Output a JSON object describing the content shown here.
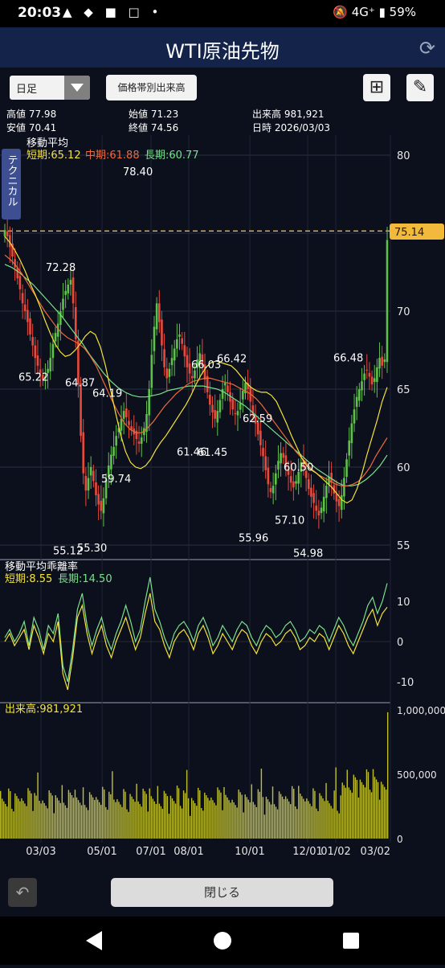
{
  "status": {
    "time": "20:03",
    "battery": "59%",
    "network": "4G⁺",
    "icons": "▲ ◆ ■ □ •"
  },
  "title": "WTI原油先物",
  "toolbar": {
    "period": "日足",
    "volume_profile_button": "価格帯別出来高"
  },
  "info": {
    "high_label": "高値",
    "high_value": "77.98",
    "open_label": "始値",
    "open_value": "71.23",
    "volume_label": "出来高",
    "volume_value": "981,921",
    "low_label": "安値",
    "low_value": "70.41",
    "close_label": "終値",
    "close_value": "74.56",
    "date_label": "日時",
    "date_value": "2026/03/03"
  },
  "side_tab": "テクニカル",
  "close_button": "閉じる",
  "colors": {
    "up": "#5ec24a",
    "down": "#e94a3a",
    "short_ma": "#f5e43a",
    "mid_ma": "#ef6a3c",
    "long_ma": "#7be08c",
    "volume": "#bfbf2c",
    "price_line": "#f2b93b",
    "bg": "#0c0f1c"
  },
  "chart_data": {
    "type": "candlestick",
    "price_panel": {
      "title": "移動平均",
      "legend": [
        {
          "label": "短期:65.12"
        },
        {
          "label": "中期:61.88"
        },
        {
          "label": "長期:60.77"
        }
      ],
      "ylim": [
        54,
        82
      ],
      "yticks": [
        "80",
        "75",
        "70",
        "65",
        "60",
        "55"
      ],
      "current_price": "75.14",
      "annotations": [
        {
          "text": "78.40",
          "x": 169,
          "y": 78.4
        },
        {
          "text": "72.28",
          "x": 73,
          "y": 72.28
        },
        {
          "text": "65.22",
          "x": 39,
          "y": 65.22
        },
        {
          "text": "64.87",
          "x": 97,
          "y": 64.87
        },
        {
          "text": "64.19",
          "x": 131,
          "y": 64.19
        },
        {
          "text": "59.74",
          "x": 142,
          "y": 59.74
        },
        {
          "text": "55.12",
          "x": 82,
          "y": 55.12
        },
        {
          "text": "55.30",
          "x": 112,
          "y": 55.3
        },
        {
          "text": "66.03",
          "x": 254,
          "y": 66.03
        },
        {
          "text": "66.42",
          "x": 286,
          "y": 66.42
        },
        {
          "text": "61.46",
          "x": 236,
          "y": 61.46
        },
        {
          "text": "61.45",
          "x": 262,
          "y": 61.45
        },
        {
          "text": "62.59",
          "x": 318,
          "y": 62.59
        },
        {
          "text": "60.50",
          "x": 369,
          "y": 60.5
        },
        {
          "text": "57.10",
          "x": 358,
          "y": 57.1
        },
        {
          "text": "55.96",
          "x": 313,
          "y": 55.96
        },
        {
          "text": "54.98",
          "x": 381,
          "y": 54.98
        },
        {
          "text": "66.48",
          "x": 431,
          "y": 66.48
        }
      ],
      "closes": [
        75.2,
        74.8,
        74.1,
        73.5,
        72.8,
        72.1,
        71.4,
        70.5,
        70.0,
        69.3,
        68.5,
        67.8,
        67.0,
        66.5,
        66.0,
        65.6,
        65.8,
        66.3,
        67.0,
        67.9,
        68.6,
        69.2,
        70.0,
        70.8,
        71.3,
        71.7,
        72.0,
        70.5,
        68.2,
        65.3,
        62.0,
        59.6,
        58.5,
        59.3,
        60.0,
        59.1,
        58.2,
        57.6,
        57.2,
        58.0,
        59.2,
        60.1,
        60.8,
        61.3,
        62.0,
        62.5,
        63.1,
        63.6,
        63.2,
        62.7,
        62.4,
        62.1,
        61.8,
        61.5,
        61.9,
        62.5,
        63.4,
        65.0,
        67.2,
        69.0,
        70.5,
        69.3,
        67.8,
        66.4,
        65.7,
        66.3,
        67.0,
        67.6,
        68.2,
        68.5,
        67.9,
        67.1,
        66.4,
        66.0,
        65.7,
        66.2,
        66.9,
        67.3,
        66.5,
        65.6,
        64.8,
        64.0,
        63.5,
        63.1,
        63.6,
        64.3,
        65.0,
        65.4,
        64.8,
        64.2,
        63.7,
        63.4,
        63.6,
        64.1,
        64.9,
        65.4,
        65.0,
        64.2,
        63.4,
        62.8,
        62.1,
        61.4,
        60.7,
        59.8,
        58.9,
        58.4,
        58.8,
        59.6,
        60.4,
        60.9,
        60.6,
        60.1,
        59.5,
        59.0,
        58.7,
        59.1,
        59.7,
        60.3,
        60.0,
        59.3,
        58.6,
        58.1,
        57.7,
        57.2,
        56.9,
        57.4,
        58.1,
        58.8,
        59.4,
        59.0,
        58.3,
        57.8,
        57.5,
        58.2,
        59.3,
        60.5,
        61.7,
        62.8,
        63.7,
        64.5,
        65.0,
        65.5,
        66.0,
        66.2,
        65.8,
        65.3,
        65.7,
        66.4,
        67.0,
        66.5,
        66.9,
        74.56
      ],
      "ma_short": [
        74.8,
        74.4,
        73.9,
        73.3,
        72.6,
        71.8,
        71.1,
        70.3,
        69.4,
        68.6,
        67.9,
        67.4,
        67.1,
        67.2,
        67.5,
        67.9,
        68.4,
        68.7,
        68.5,
        67.7,
        66.5,
        65.0,
        63.5,
        62.1,
        61.0,
        60.3,
        60.0,
        59.9,
        60.1,
        60.5,
        61.1,
        61.6,
        62.0,
        62.5,
        63.0,
        63.5,
        64.0,
        64.6,
        65.3,
        65.9,
        66.4,
        66.7,
        66.8,
        66.7,
        66.6,
        66.5,
        66.2,
        65.8,
        65.4,
        65.1,
        64.9,
        64.8,
        64.8,
        64.6,
        64.2,
        63.5,
        62.8,
        62.0,
        61.3,
        60.6,
        60.1,
        59.8,
        59.6,
        59.3,
        59.0,
        58.7,
        58.3,
        57.9,
        57.7,
        57.9,
        58.6,
        59.6,
        60.8,
        61.9,
        63.0,
        64.2,
        65.12
      ],
      "ma_mid": [
        73.6,
        73.3,
        72.9,
        72.4,
        71.8,
        71.2,
        70.6,
        70.0,
        69.5,
        69.0,
        68.6,
        68.3,
        68.1,
        67.9,
        67.6,
        67.1,
        66.5,
        65.7,
        64.9,
        64.1,
        63.4,
        62.8,
        62.4,
        62.2,
        62.2,
        62.5,
        62.9,
        63.4,
        63.9,
        64.3,
        64.7,
        65.0,
        65.3,
        65.5,
        65.6,
        65.7,
        65.7,
        65.6,
        65.5,
        65.4,
        65.3,
        65.1,
        64.9,
        64.7,
        64.4,
        64.0,
        63.5,
        63.0,
        62.5,
        62.0,
        61.5,
        61.0,
        60.6,
        60.2,
        59.8,
        59.5,
        59.3,
        59.1,
        58.9,
        58.8,
        58.8,
        58.9,
        59.1,
        59.5,
        60.0,
        60.7,
        61.3,
        61.88
      ],
      "ma_long": [
        73.0,
        72.8,
        72.5,
        72.1,
        71.7,
        71.2,
        70.7,
        70.2,
        69.7,
        69.1,
        68.5,
        67.9,
        67.2,
        66.6,
        66.0,
        65.5,
        65.1,
        64.8,
        64.6,
        64.5,
        64.5,
        64.6,
        64.7,
        64.9,
        65.0,
        65.1,
        65.2,
        65.2,
        65.2,
        65.1,
        65.0,
        64.8,
        64.5,
        64.2,
        63.9,
        63.5,
        63.1,
        62.7,
        62.3,
        61.9,
        61.5,
        61.1,
        60.7,
        60.3,
        59.9,
        59.6,
        59.3,
        59.0,
        58.8,
        58.8,
        58.9,
        59.2,
        59.6,
        60.1,
        60.77
      ]
    },
    "deviation_panel": {
      "title": "移動平均乖離率",
      "legend": [
        {
          "label": "短期:8.55"
        },
        {
          "label": "長期:14.50"
        }
      ],
      "ylim": [
        -13,
        16
      ],
      "yticks": [
        "10",
        "0",
        "-10"
      ],
      "short": [
        0,
        2,
        -1,
        1,
        3,
        -2,
        4,
        1,
        -3,
        2,
        0,
        5,
        -8,
        -12,
        -4,
        6,
        9,
        2,
        -3,
        1,
        4,
        -1,
        -4,
        0,
        3,
        6,
        2,
        -2,
        1,
        7,
        12,
        5,
        3,
        -1,
        -4,
        0,
        2,
        3,
        1,
        -2,
        2,
        4,
        1,
        -3,
        -1,
        2,
        0,
        -2,
        1,
        3,
        2,
        -1,
        -3,
        0,
        2,
        1,
        -1,
        0,
        2,
        3,
        1,
        -2,
        -1,
        1,
        0,
        2,
        1,
        -2,
        1,
        4,
        2,
        -1,
        -3,
        0,
        3,
        6,
        8,
        4,
        7,
        8.55
      ],
      "long": [
        1,
        3,
        0,
        2,
        5,
        -1,
        6,
        3,
        -2,
        4,
        2,
        7,
        -6,
        -10,
        -2,
        8,
        12,
        4,
        -1,
        3,
        6,
        1,
        -2,
        2,
        5,
        9,
        5,
        0,
        3,
        10,
        16,
        8,
        5,
        1,
        -2,
        2,
        4,
        5,
        3,
        0,
        4,
        6,
        3,
        -1,
        1,
        4,
        2,
        0,
        3,
        5,
        4,
        1,
        -1,
        2,
        4,
        3,
        1,
        2,
        4,
        5,
        3,
        0,
        1,
        3,
        2,
        4,
        3,
        0,
        3,
        6,
        4,
        1,
        -1,
        2,
        5,
        9,
        11,
        7,
        10,
        14.5
      ]
    },
    "volume_panel": {
      "title": "出来高:981,921",
      "ylim": [
        0,
        1000000
      ],
      "yticks": [
        "1,000,000",
        "500,000",
        "0"
      ]
    },
    "x_labels": [
      "03/03",
      "05/01",
      "07/01",
      "08/01",
      "10/01",
      "12/01",
      "01/02",
      "03/02"
    ]
  }
}
